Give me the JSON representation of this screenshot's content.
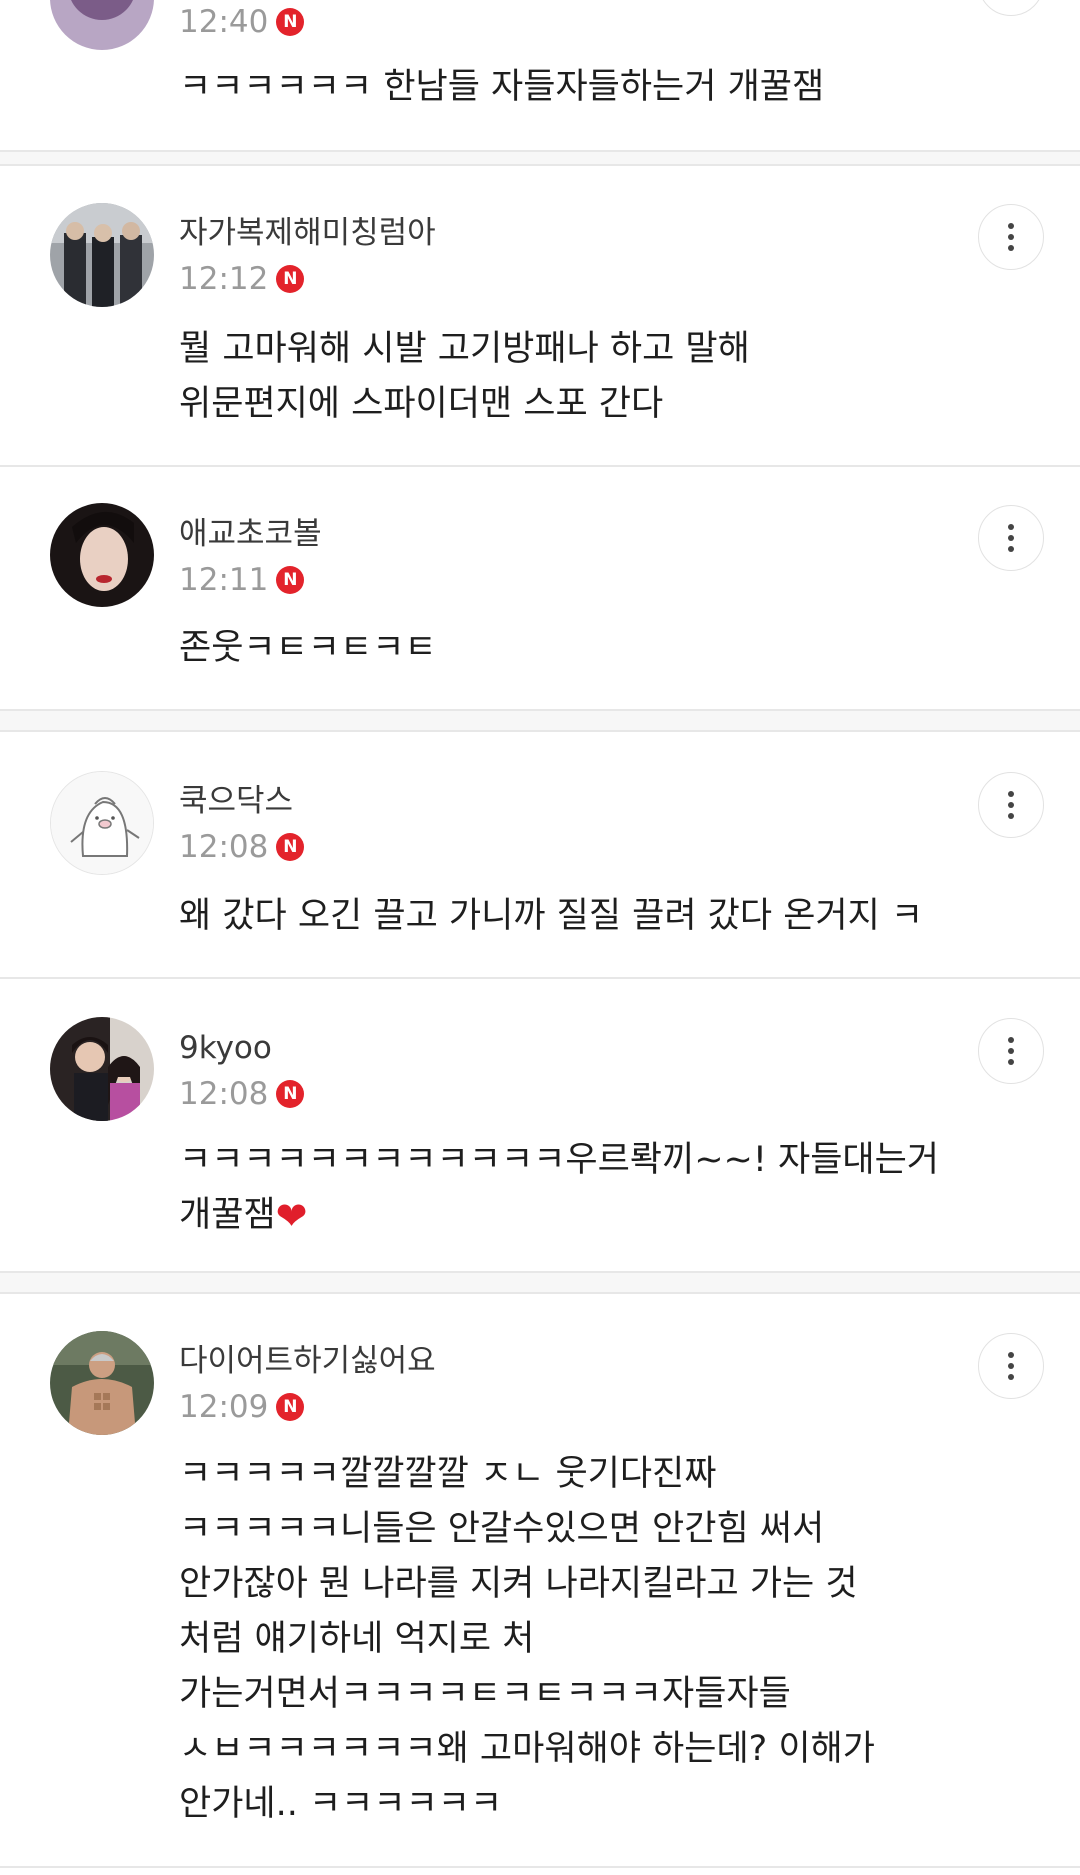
{
  "badge_label": "N",
  "comments": [
    {
      "time": "12:40",
      "text": "ㅋㅋㅋㅋㅋㅋ 한남들 자들자들하는거 개꿀잼"
    },
    {
      "nickname": "자가복제해미칭럼아",
      "time": "12:12",
      "text": "뭘 고마워해 시발 고기방패나 하고 말해\n위문편지에 스파이더맨 스포 간다"
    },
    {
      "nickname": "애교초코볼",
      "time": "12:11",
      "text": "존웃ㅋㅌㅋㅌㅋㅌ"
    },
    {
      "nickname": "쿡으닥스",
      "time": "12:08",
      "text": "왜 갔다 오긴 끌고 가니까 질질 끌려 갔다 온거지 ㅋ"
    },
    {
      "nickname": "9kyoo",
      "time": "12:08",
      "text": "ㅋㅋㅋㅋㅋㅋㅋㅋㅋㅋㅋㅋ우르롹끼~~! 자들대는거\n개꿀잼",
      "emoji": "❤"
    },
    {
      "nickname": "다이어트하기싫어요",
      "time": "12:09",
      "text": "ㅋㅋㅋㅋㅋ깔깔깔깔 ㅈㄴ 웃기다진짜\nㅋㅋㅋㅋㅋ니들은 안갈수있으면 안간힘 써서\n안가잖아 뭔 나라를 지켜 나라지킬라고 가는 것\n처럼 얘기하네 억지로 처\n가는거면서ㅋㅋㅋㅋㅌㅋㅌㅋㅋㅋ자들자들\nㅅㅂㅋㅋㅋㅋㅋㅋ왜 고마워해야 하는데? 이해가\n안가네.. ㅋㅋㅋㅋㅋㅋ"
    }
  ],
  "colors": {
    "badge": "#e3232b",
    "time": "#9a9a9a",
    "divider": "#e7e7e7"
  }
}
